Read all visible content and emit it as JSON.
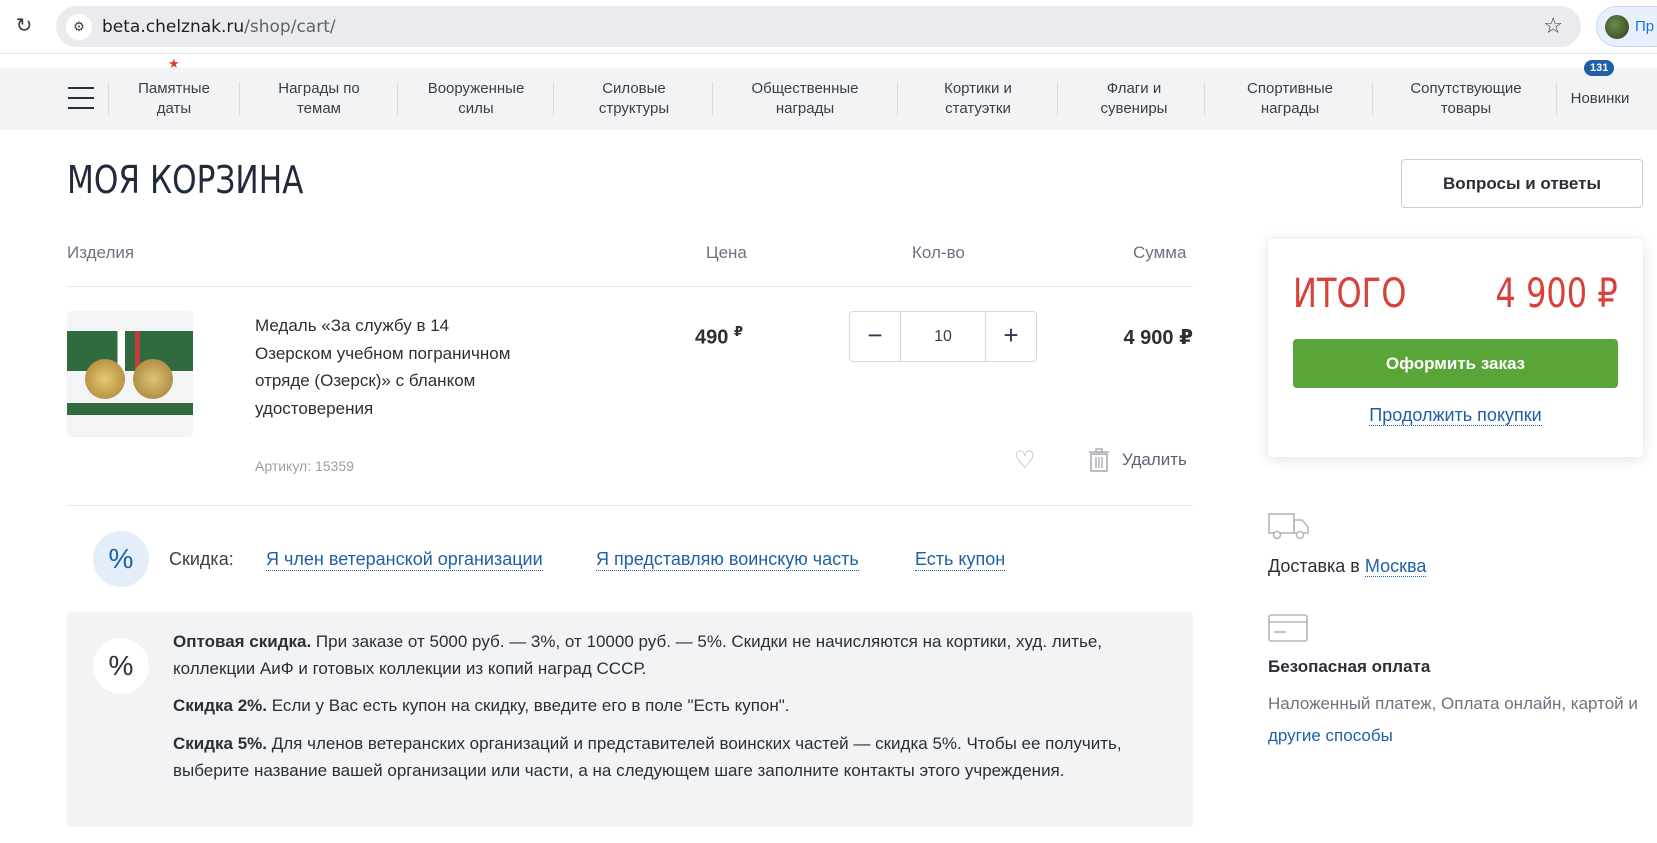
{
  "browser": {
    "url_host": "beta.chelznak.ru",
    "url_path": "/shop/cart/",
    "profile_label": "Пр"
  },
  "nav": {
    "items": [
      {
        "label": "Памятные даты"
      },
      {
        "label": "Награды по темам"
      },
      {
        "label": "Вооруженные силы"
      },
      {
        "label": "Силовые структуры"
      },
      {
        "label": "Общественные награды"
      },
      {
        "label": "Кортики и статуэтки"
      },
      {
        "label": "Флаги и сувениры"
      },
      {
        "label": "Спортивные награды"
      },
      {
        "label": "Сопутствующие товары"
      },
      {
        "label": "Новинки"
      }
    ],
    "new_badge": "131"
  },
  "page": {
    "title": "МОЯ КОРЗИНА",
    "faq_button": "Вопросы и ответы"
  },
  "table": {
    "col_items": "Изделия",
    "col_price": "Цена",
    "col_qty": "Кол-во",
    "col_sum": "Сумма"
  },
  "product": {
    "name": "Медаль «За службу в 14 Озерском учебном пограничном отряде (Озерск)» с бланком удостоверения",
    "sku": "Артикул: 15359",
    "price": "490",
    "currency": "₽",
    "qty": "10",
    "sum": "4 900 ₽",
    "delete_label": "Удалить"
  },
  "discount": {
    "label": "Скидка:",
    "options": [
      {
        "label": "Я член ветеранской организации"
      },
      {
        "label": "Я представляю воинскую часть"
      },
      {
        "label": "Есть купон"
      }
    ]
  },
  "info": {
    "p1_bold": "Оптовая скидка.",
    "p1_text": " При заказе от 5000 руб. — 3%, от 10000 руб. — 5%. Скидки не начисляются на кортики, худ. литье, коллекции АиФ и готовых коллекции из копий наград СССР.",
    "p2_bold": "Скидка 2%.",
    "p2_text": " Если у Вас есть купон на скидку, введите его в поле \"Есть купон\".",
    "p3_bold": "Скидка 5%.",
    "p3_text": " Для членов ветеранских организаций и представителей воинских частей — скидка 5%. Чтобы ее получить, выберите название вашей организации или части, а на следующем шаге заполните контакты этого учреждения."
  },
  "summary": {
    "title": "ИТОГО",
    "total": "4 900 ₽",
    "checkout_button": "Оформить заказ",
    "continue_link": "Продолжить покупки"
  },
  "delivery": {
    "prefix": "Доставка в ",
    "city": "Москва"
  },
  "payment": {
    "title": "Безопасная оплата",
    "text": "Наложенный платеж, Оплата онлайн, картой и ",
    "link": "другие способы"
  },
  "colors": {
    "accent": "#1f5fa8",
    "total_red": "#d8403a",
    "checkout_green": "#5aa537"
  }
}
